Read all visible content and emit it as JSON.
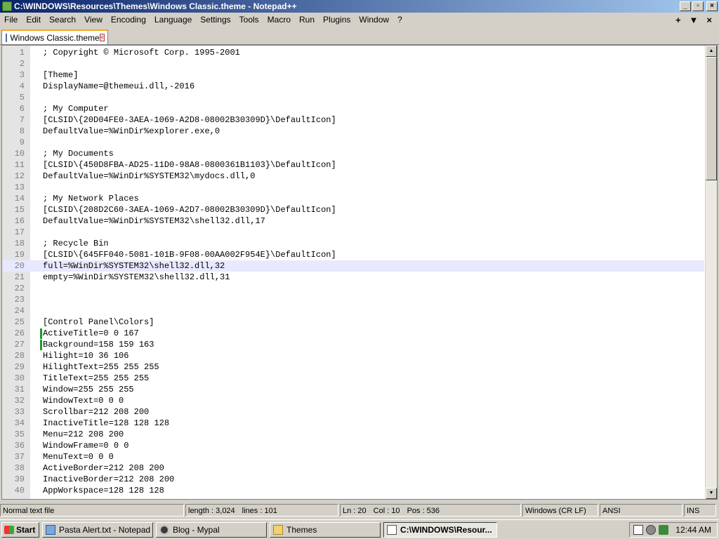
{
  "window": {
    "title": "C:\\WINDOWS\\Resources\\Themes\\Windows Classic.theme - Notepad++",
    "min_glyph": "_",
    "max_glyph": "▫",
    "close_glyph": "×"
  },
  "menu": {
    "items": [
      "File",
      "Edit",
      "Search",
      "View",
      "Encoding",
      "Language",
      "Settings",
      "Tools",
      "Macro",
      "Run",
      "Plugins",
      "Window",
      "?"
    ],
    "right": [
      "+",
      "▼",
      "×"
    ]
  },
  "tab": {
    "label": "Windows Classic.theme",
    "close_glyph": "×"
  },
  "editor": {
    "current_line": 20,
    "change_marker_lines": [
      26,
      27
    ],
    "lines": [
      {
        "n": "1",
        "text": "; Copyright © Microsoft Corp. 1995-2001"
      },
      {
        "n": "2",
        "text": ""
      },
      {
        "n": "3",
        "text": "[Theme]"
      },
      {
        "n": "4",
        "text": "DisplayName=@themeui.dll,-2016"
      },
      {
        "n": "5",
        "text": ""
      },
      {
        "n": "6",
        "text": "; My Computer"
      },
      {
        "n": "7",
        "text": "[CLSID\\{20D04FE0-3AEA-1069-A2D8-08002B30309D}\\DefaultIcon]"
      },
      {
        "n": "8",
        "text": "DefaultValue=%WinDir%explorer.exe,0"
      },
      {
        "n": "9",
        "text": ""
      },
      {
        "n": "10",
        "text": "; My Documents"
      },
      {
        "n": "11",
        "text": "[CLSID\\{450D8FBA-AD25-11D0-98A8-0800361B1103}\\DefaultIcon]"
      },
      {
        "n": "12",
        "text": "DefaultValue=%WinDir%SYSTEM32\\mydocs.dll,0"
      },
      {
        "n": "13",
        "text": ""
      },
      {
        "n": "14",
        "text": "; My Network Places"
      },
      {
        "n": "15",
        "text": "[CLSID\\{208D2C60-3AEA-1069-A2D7-08002B30309D}\\DefaultIcon]"
      },
      {
        "n": "16",
        "text": "DefaultValue=%WinDir%SYSTEM32\\shell32.dll,17"
      },
      {
        "n": "17",
        "text": ""
      },
      {
        "n": "18",
        "text": "; Recycle Bin"
      },
      {
        "n": "19",
        "text": "[CLSID\\{645FF040-5081-101B-9F08-00AA002F954E}\\DefaultIcon]"
      },
      {
        "n": "20",
        "text": "full=%WinDir%SYSTEM32\\shell32.dll,32"
      },
      {
        "n": "21",
        "text": "empty=%WinDir%SYSTEM32\\shell32.dll,31"
      },
      {
        "n": "22",
        "text": ""
      },
      {
        "n": "23",
        "text": ""
      },
      {
        "n": "24",
        "text": ""
      },
      {
        "n": "25",
        "text": "[Control Panel\\Colors]"
      },
      {
        "n": "26",
        "text": "ActiveTitle=0 0 167"
      },
      {
        "n": "27",
        "text": "Background=158 159 163"
      },
      {
        "n": "28",
        "text": "Hilight=10 36 106"
      },
      {
        "n": "29",
        "text": "HilightText=255 255 255"
      },
      {
        "n": "30",
        "text": "TitleText=255 255 255"
      },
      {
        "n": "31",
        "text": "Window=255 255 255"
      },
      {
        "n": "32",
        "text": "WindowText=0 0 0"
      },
      {
        "n": "33",
        "text": "Scrollbar=212 208 200"
      },
      {
        "n": "34",
        "text": "InactiveTitle=128 128 128"
      },
      {
        "n": "35",
        "text": "Menu=212 208 200"
      },
      {
        "n": "36",
        "text": "WindowFrame=0 0 0"
      },
      {
        "n": "37",
        "text": "MenuText=0 0 0"
      },
      {
        "n": "38",
        "text": "ActiveBorder=212 208 200"
      },
      {
        "n": "39",
        "text": "InactiveBorder=212 208 200"
      },
      {
        "n": "40",
        "text": "AppWorkspace=128 128 128"
      }
    ]
  },
  "status": {
    "file_type": "Normal text file",
    "length": "length : 3,024",
    "lines": "lines : 101",
    "ln": "Ln : 20",
    "col": "Col : 10",
    "pos": "Pos : 536",
    "eol": "Windows (CR LF)",
    "encoding": "ANSI",
    "mode": "INS"
  },
  "taskbar": {
    "start": "Start",
    "tasks": [
      {
        "label": "Pasta Alert.txt - Notepad",
        "icon": "notepad-icon"
      },
      {
        "label": "Blog - Mypal",
        "icon": "mypal-icon"
      },
      {
        "label": "Themes",
        "icon": "folder-icon"
      },
      {
        "label": "C:\\WINDOWS\\Resour...",
        "icon": "notepadpp-icon"
      }
    ],
    "clock": "12:44 AM"
  }
}
